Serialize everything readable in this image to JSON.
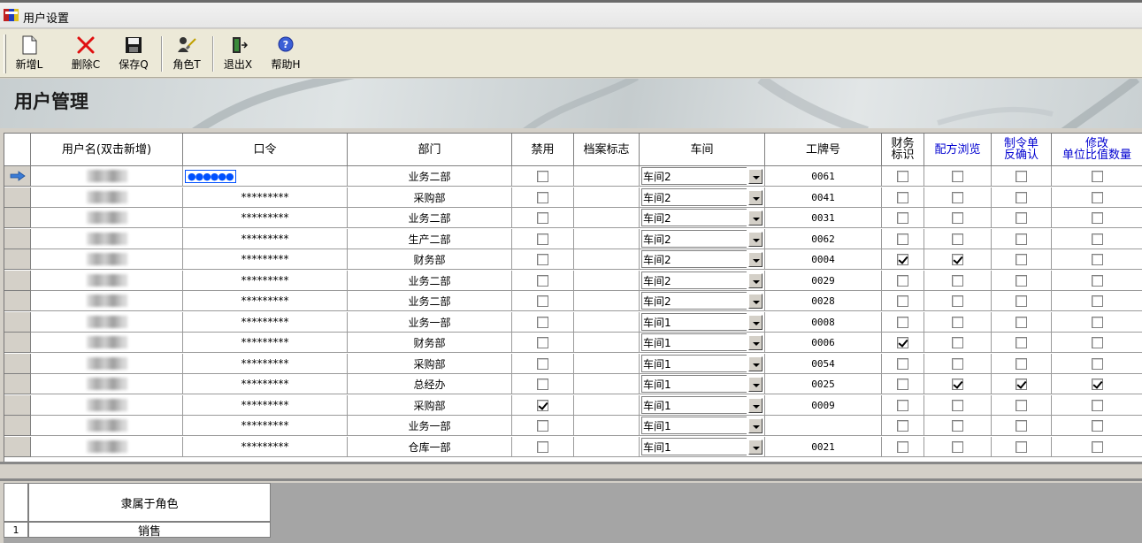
{
  "window": {
    "title": "用户设置"
  },
  "toolbar": {
    "buttons": [
      {
        "label": "新增L",
        "icon": "new-document-icon"
      },
      {
        "label": "删除C",
        "icon": "delete-x-icon"
      },
      {
        "label": "保存Q",
        "icon": "save-floppy-icon"
      },
      {
        "label": "角色T",
        "icon": "role-users-icon"
      },
      {
        "label": "退出X",
        "icon": "exit-door-icon"
      },
      {
        "label": "帮助H",
        "icon": "help-icon"
      }
    ]
  },
  "banner": {
    "title": "用户管理"
  },
  "grid": {
    "columns": [
      "用户名(双击新增)",
      "口令",
      "部门",
      "禁用",
      "档案标志",
      "车间",
      "工牌号",
      "财务标识",
      "配方浏览",
      "制令单反确认",
      "修改单位比值数量"
    ],
    "column_lines": {
      "finance": [
        "财务",
        "标识"
      ],
      "reverse": [
        "制令单",
        "反确认"
      ],
      "modify": [
        "修改",
        "单位比值数量"
      ]
    },
    "editing_password": "●●●●●●",
    "rows": [
      {
        "password": "",
        "dept": "业务二部",
        "disabled": false,
        "workshop": "车间2",
        "badge": "0061",
        "finance": false,
        "recipe": false,
        "reverse": false,
        "modify": false
      },
      {
        "password": "*********",
        "dept": "采购部",
        "disabled": false,
        "workshop": "车间2",
        "badge": "0041",
        "finance": false,
        "recipe": false,
        "reverse": false,
        "modify": false
      },
      {
        "password": "*********",
        "dept": "业务二部",
        "disabled": false,
        "workshop": "车间2",
        "badge": "0031",
        "finance": false,
        "recipe": false,
        "reverse": false,
        "modify": false
      },
      {
        "password": "*********",
        "dept": "生产二部",
        "disabled": false,
        "workshop": "车间2",
        "badge": "0062",
        "finance": false,
        "recipe": false,
        "reverse": false,
        "modify": false
      },
      {
        "password": "*********",
        "dept": "财务部",
        "disabled": false,
        "workshop": "车间2",
        "badge": "0004",
        "finance": true,
        "recipe": true,
        "reverse": false,
        "modify": false
      },
      {
        "password": "*********",
        "dept": "业务二部",
        "disabled": false,
        "workshop": "车间2",
        "badge": "0029",
        "finance": false,
        "recipe": false,
        "reverse": false,
        "modify": false
      },
      {
        "password": "*********",
        "dept": "业务二部",
        "disabled": false,
        "workshop": "车间2",
        "badge": "0028",
        "finance": false,
        "recipe": false,
        "reverse": false,
        "modify": false
      },
      {
        "password": "*********",
        "dept": "业务一部",
        "disabled": false,
        "workshop": "车间1",
        "badge": "0008",
        "finance": false,
        "recipe": false,
        "reverse": false,
        "modify": false
      },
      {
        "password": "*********",
        "dept": "财务部",
        "disabled": false,
        "workshop": "车间1",
        "badge": "0006",
        "finance": true,
        "recipe": false,
        "reverse": false,
        "modify": false
      },
      {
        "password": "*********",
        "dept": "采购部",
        "disabled": false,
        "workshop": "车间1",
        "badge": "0054",
        "finance": false,
        "recipe": false,
        "reverse": false,
        "modify": false
      },
      {
        "password": "*********",
        "dept": "总经办",
        "disabled": false,
        "workshop": "车间1",
        "badge": "0025",
        "finance": false,
        "recipe": true,
        "reverse": true,
        "modify": true
      },
      {
        "password": "*********",
        "dept": "采购部",
        "disabled": true,
        "workshop": "车间1",
        "badge": "0009",
        "finance": false,
        "recipe": false,
        "reverse": false,
        "modify": false
      },
      {
        "password": "*********",
        "dept": "业务一部",
        "disabled": false,
        "workshop": "车间1",
        "badge": "",
        "finance": false,
        "recipe": false,
        "reverse": false,
        "modify": false
      },
      {
        "password": "*********",
        "dept": "仓库一部",
        "disabled": false,
        "workshop": "车间1",
        "badge": "0021",
        "finance": false,
        "recipe": false,
        "reverse": false,
        "modify": false
      }
    ]
  },
  "roles": {
    "header": "隶属于角色",
    "rows": [
      {
        "num": "1",
        "name": "销售"
      }
    ]
  }
}
